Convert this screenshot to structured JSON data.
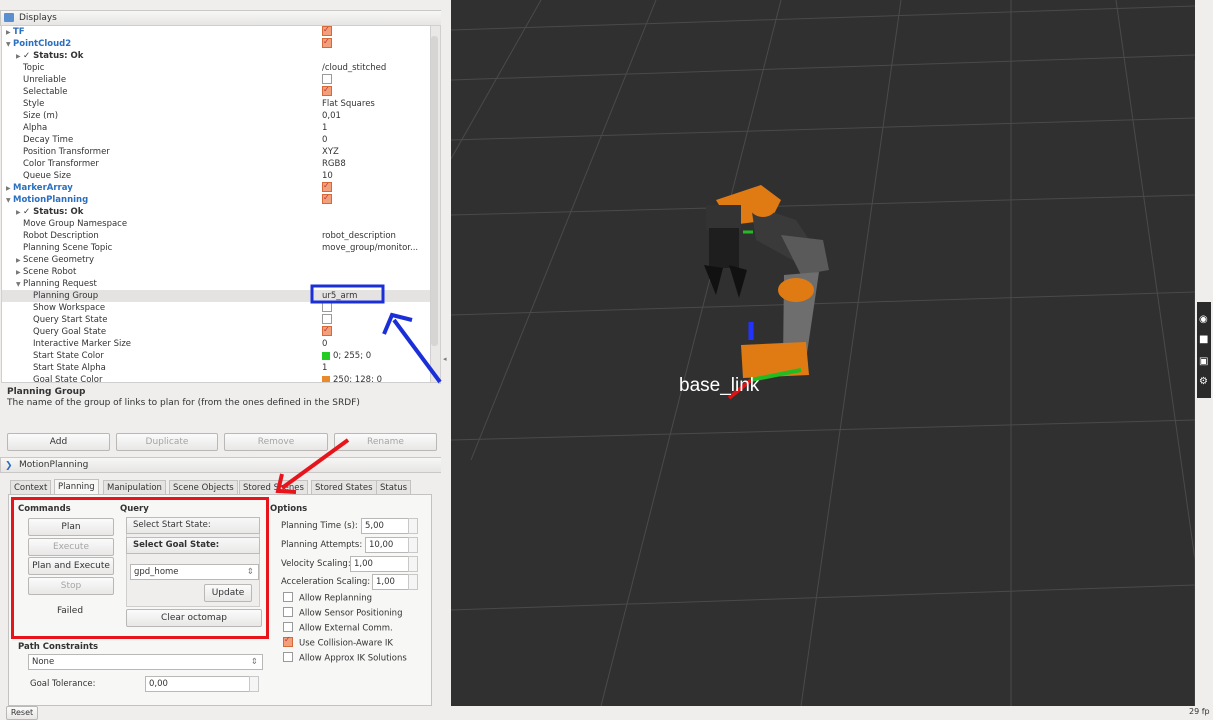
{
  "displays": {
    "title": "Displays",
    "items": [
      {
        "label": "TF",
        "level": 0,
        "expand": "collapsed",
        "value": "",
        "check": "on",
        "blue": true
      },
      {
        "label": "PointCloud2",
        "level": 0,
        "expand": "expanded",
        "value": "",
        "check": "on",
        "blue": true
      },
      {
        "label": "✓ Status: Ok",
        "level": 1,
        "expand": "collapsed",
        "value": "",
        "check": "",
        "blue": false,
        "bold": true
      },
      {
        "label": "Topic",
        "level": 1,
        "value": "/cloud_stitched"
      },
      {
        "label": "Unreliable",
        "level": 1,
        "value": "",
        "check": "off"
      },
      {
        "label": "Selectable",
        "level": 1,
        "value": "",
        "check": "on"
      },
      {
        "label": "Style",
        "level": 1,
        "value": "Flat Squares"
      },
      {
        "label": "Size (m)",
        "level": 1,
        "value": "0,01"
      },
      {
        "label": "Alpha",
        "level": 1,
        "value": "1"
      },
      {
        "label": "Decay Time",
        "level": 1,
        "value": "0"
      },
      {
        "label": "Position Transformer",
        "level": 1,
        "value": "XYZ"
      },
      {
        "label": "Color Transformer",
        "level": 1,
        "value": "RGB8"
      },
      {
        "label": "Queue Size",
        "level": 1,
        "value": "10"
      },
      {
        "label": "MarkerArray",
        "level": 0,
        "expand": "collapsed",
        "value": "",
        "check": "on",
        "blue": true
      },
      {
        "label": "MotionPlanning",
        "level": 0,
        "expand": "expanded",
        "value": "",
        "check": "on",
        "blue": true
      },
      {
        "label": "✓ Status: Ok",
        "level": 1,
        "expand": "collapsed",
        "value": "",
        "bold": true
      },
      {
        "label": "Move Group Namespace",
        "level": 1,
        "value": ""
      },
      {
        "label": "Robot Description",
        "level": 1,
        "value": "robot_description"
      },
      {
        "label": "Planning Scene Topic",
        "level": 1,
        "value": "move_group/monitor..."
      },
      {
        "label": "Scene Geometry",
        "level": 1,
        "expand": "collapsed",
        "value": ""
      },
      {
        "label": "Scene Robot",
        "level": 1,
        "expand": "collapsed",
        "value": ""
      },
      {
        "label": "Planning Request",
        "level": 1,
        "expand": "expanded",
        "value": ""
      },
      {
        "label": "Planning Group",
        "level": 2,
        "value": "ur5_arm",
        "selected": true
      },
      {
        "label": "Show Workspace",
        "level": 2,
        "value": "",
        "check": "off"
      },
      {
        "label": "Query Start State",
        "level": 2,
        "value": "",
        "check": "off"
      },
      {
        "label": "Query Goal State",
        "level": 2,
        "value": "",
        "check": "on"
      },
      {
        "label": "Interactive Marker Size",
        "level": 2,
        "value": "0"
      },
      {
        "label": "Start State Color",
        "level": 2,
        "value": "0; 255; 0",
        "swatch": "#22cc22"
      },
      {
        "label": "Start State Alpha",
        "level": 2,
        "value": "1"
      },
      {
        "label": "Goal State Color",
        "level": 2,
        "value": "250; 128; 0",
        "swatch": "#e88a2a"
      }
    ]
  },
  "description": {
    "title": "Planning Group",
    "text": "The name of the group of links to plan for (from the ones defined in the SRDF)"
  },
  "display_buttons": {
    "add": "Add",
    "duplicate": "Duplicate",
    "remove": "Remove",
    "rename": "Rename"
  },
  "motion_planning": {
    "title": "MotionPlanning",
    "tabs": [
      "Context",
      "Planning",
      "Manipulation",
      "Scene Objects",
      "Stored Scenes",
      "Stored States",
      "Status"
    ],
    "active_tab": "Planning",
    "commands": {
      "title": "Commands",
      "plan": "Plan",
      "execute": "Execute",
      "plan_and_execute": "Plan and Execute",
      "stop": "Stop",
      "status": "Failed"
    },
    "query": {
      "title": "Query",
      "select_start": "Select Start State:",
      "select_goal": "Select Goal State:",
      "goal_value": "gpd_home",
      "update": "Update",
      "clear_octomap": "Clear octomap"
    },
    "options": {
      "title": "Options",
      "planning_time_label": "Planning Time (s):",
      "planning_time": "5,00",
      "planning_attempts_label": "Planning Attempts:",
      "planning_attempts": "10,00",
      "velocity_label": "Velocity Scaling:",
      "velocity": "1,00",
      "accel_label": "Acceleration Scaling:",
      "accel": "1,00",
      "checks": [
        {
          "label": "Allow Replanning",
          "checked": false
        },
        {
          "label": "Allow Sensor Positioning",
          "checked": false
        },
        {
          "label": "Allow External Comm.",
          "checked": false
        },
        {
          "label": "Use Collision-Aware IK",
          "checked": true
        },
        {
          "label": "Allow Approx IK Solutions",
          "checked": false
        }
      ]
    },
    "path_constraints": {
      "title": "Path Constraints",
      "value": "None",
      "goal_tolerance_label": "Goal Tolerance:",
      "goal_tolerance": "0,00"
    }
  },
  "viewport": {
    "frame_label": "base_link",
    "fps": "29 fp"
  },
  "statusbar": {
    "reset": "Reset"
  },
  "colors": {
    "annotation_red": "#e8141c",
    "annotation_blue": "#1b2fd8",
    "link_blue": "#2a6fc0",
    "robot_orange": "#e07b14"
  }
}
